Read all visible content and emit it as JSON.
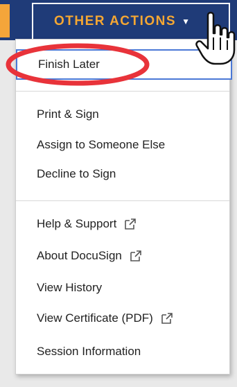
{
  "header": {
    "button_label": "OTHER ACTIONS"
  },
  "menu": {
    "primary": {
      "label": "Finish Later"
    },
    "group_one": [
      {
        "label": "Print & Sign"
      },
      {
        "label": "Assign to Someone Else"
      },
      {
        "label": "Decline to Sign"
      }
    ],
    "group_two": [
      {
        "label": "Help & Support",
        "external": true
      },
      {
        "label": "About DocuSign",
        "external": true
      },
      {
        "label": "View History",
        "external": false
      },
      {
        "label": "View Certificate (PDF)",
        "external": true
      },
      {
        "label": "Session Information",
        "external": false
      }
    ]
  },
  "colors": {
    "navy": "#1f3b78",
    "accent": "#f5a733",
    "highlight_ring": "#e8333a",
    "focus_border": "#4a78d6"
  },
  "icons": {
    "caret": "chevron-down-icon",
    "external": "external-link-icon",
    "cursor": "hand-pointer-icon"
  }
}
